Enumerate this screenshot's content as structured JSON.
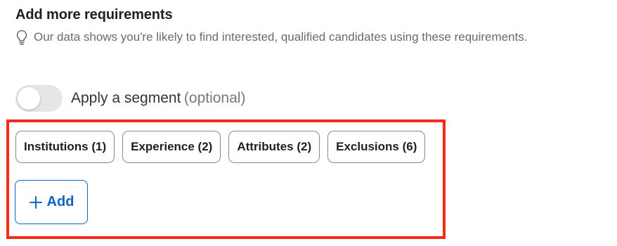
{
  "section": {
    "title": "Add more requirements",
    "hint": "Our data shows you're likely to find interested, qualified candidates using these requirements.",
    "hint_icon": "lightbulb-icon"
  },
  "segment": {
    "label": "Apply a segment",
    "optional": "(optional)",
    "enabled": false
  },
  "chips": [
    {
      "label": "Institutions (1)"
    },
    {
      "label": "Experience (2)"
    },
    {
      "label": "Attributes (2)"
    },
    {
      "label": "Exclusions (6)"
    }
  ],
  "add": {
    "label": "Add",
    "icon": "plus-icon"
  },
  "colors": {
    "accent": "#0a66c2",
    "highlight": "#f52a17",
    "toggle_off": "#e6e6e6"
  }
}
